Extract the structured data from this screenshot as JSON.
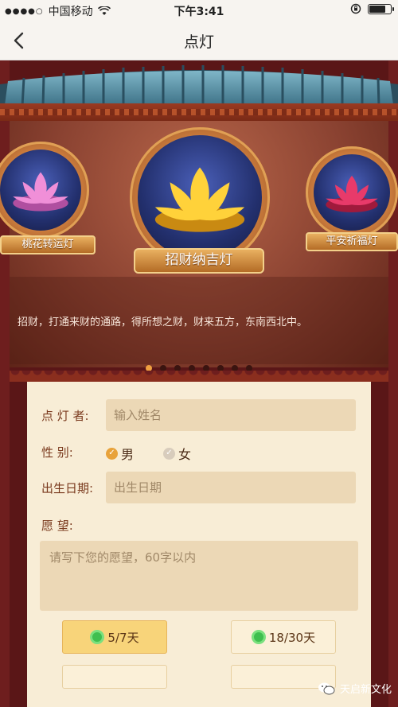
{
  "status_bar": {
    "signal_dots": "●●●●○",
    "carrier": "中国移动",
    "wifi_icon": "wifi-icon",
    "time": "下午3:41",
    "battery_level": 0.85
  },
  "nav": {
    "title": "点灯",
    "back_icon": "chevron-left-icon"
  },
  "lamps": [
    {
      "name": "桃花转运灯",
      "petal_color": "#f08fd8"
    },
    {
      "name": "招财纳吉灯",
      "petal_color": "#ffd23a"
    },
    {
      "name": "平安祈福灯",
      "petal_color": "#e83a6a"
    }
  ],
  "description": "招财，打通来财的通路，得所想之财，财来五方，东南西北中。",
  "carousel": {
    "total": 8,
    "active": 0
  },
  "form": {
    "lighter_label": "点  灯  者:",
    "lighter_placeholder": "输入姓名",
    "gender_label": "性        别:",
    "gender_male": "男",
    "gender_female": "女",
    "gender_selected": "男",
    "birth_label": "出生日期:",
    "birth_placeholder": "出生日期",
    "wish_label": "愿        望:",
    "wish_placeholder": "请写下您的愿望，60字以内"
  },
  "durations": [
    {
      "label": "5/7天",
      "selected": true
    },
    {
      "label": "18/30天",
      "selected": false
    }
  ],
  "watermark": "天启新文化",
  "colors": {
    "accent": "#f0a040",
    "frame": "#6e1e1e",
    "panel": "#f8edd6"
  }
}
